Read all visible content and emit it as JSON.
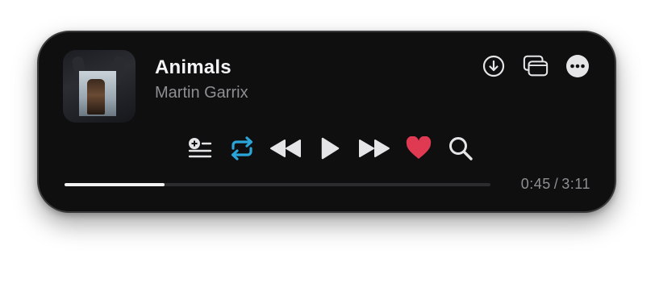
{
  "track": {
    "title": "Animals",
    "artist": "Martin Garrix",
    "artwork_icon": "album-artwork"
  },
  "top_actions": [
    {
      "name": "download-button",
      "icon": "download-circle-icon"
    },
    {
      "name": "miniplayer-button",
      "icon": "picture-in-picture-icon"
    },
    {
      "name": "more-options-button",
      "icon": "ellipsis-circle-icon"
    }
  ],
  "controls": [
    {
      "name": "add-to-queue-button",
      "icon": "add-to-queue-icon"
    },
    {
      "name": "repeat-button",
      "icon": "repeat-icon"
    },
    {
      "name": "previous-button",
      "icon": "backward-icon"
    },
    {
      "name": "play-button",
      "icon": "play-icon"
    },
    {
      "name": "next-button",
      "icon": "forward-icon"
    },
    {
      "name": "like-button",
      "icon": "heart-icon"
    },
    {
      "name": "search-button",
      "icon": "search-icon"
    }
  ],
  "playback": {
    "elapsed": "0:45",
    "separator": "/",
    "duration": "3:11",
    "progress_fraction": 0.235
  },
  "colors": {
    "background": "#0f0f10",
    "accent_repeat": "#2aa7d8",
    "heart": "#e03a52",
    "primary_text": "#f5f5f7",
    "secondary_text": "#8e8e93",
    "icon": "#e5e5e7"
  }
}
